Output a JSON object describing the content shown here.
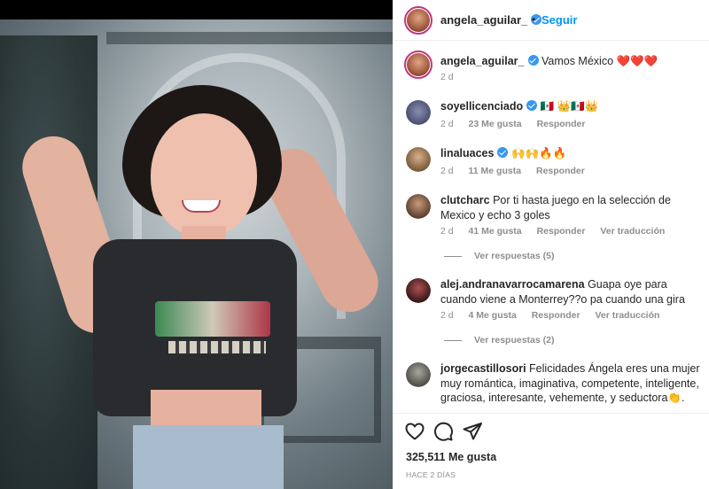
{
  "post": {
    "author": "angela_aguilar_",
    "follow_label": "Seguir",
    "separator": "•",
    "caption_user": "angela_aguilar_",
    "caption_text": "Vamos México ❤️❤️❤️",
    "caption_time": "2 d"
  },
  "comments": [
    {
      "user": "soyellicenciado",
      "verified": true,
      "text": "🇲🇽 👑🇲🇽👑",
      "time": "2 d",
      "likes": "23 Me gusta",
      "reply": "Responder",
      "translate": ""
    },
    {
      "user": "linaluaces",
      "verified": true,
      "text": "🙌🙌🔥🔥",
      "time": "2 d",
      "likes": "11 Me gusta",
      "reply": "Responder",
      "translate": ""
    },
    {
      "user": "clutcharc",
      "verified": false,
      "text": "Por ti hasta juego en la selección de Mexico y echo 3 goles",
      "time": "2 d",
      "likes": "41 Me gusta",
      "reply": "Responder",
      "translate": "Ver traducción",
      "view_replies": "Ver respuestas (5)"
    },
    {
      "user": "alej.andranavarrocamarena",
      "verified": false,
      "text": "Guapa oye para cuando viene a Monterrey??o pa cuando una gira",
      "time": "2 d",
      "likes": "4 Me gusta",
      "reply": "Responder",
      "translate": "Ver traducción",
      "view_replies": "Ver respuestas (2)"
    },
    {
      "user": "jorgecastillosori",
      "verified": false,
      "text": "Felicidades Ángela eres una mujer muy romántica, imaginativa, competente, inteligente, graciosa, interesante, vehemente, y seductora👏."
    }
  ],
  "footer": {
    "likes": "325,511 Me gusta",
    "ago": "HACE 2 DÍAS"
  },
  "icons": [
    "heart-icon",
    "comment-icon",
    "share-icon",
    "verified-icon"
  ],
  "colors": {
    "accent": "#0095f6",
    "verified": "#3897f0",
    "muted": "#8e8e8e"
  }
}
